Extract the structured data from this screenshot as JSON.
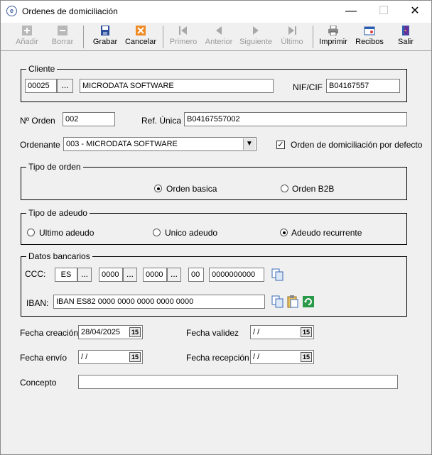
{
  "window": {
    "title": "Ordenes de domiciliación",
    "minimize": "—",
    "maximize": "☐",
    "close": "✕"
  },
  "toolbar": {
    "add": "Añadir",
    "delete": "Borrar",
    "save": "Grabar",
    "cancel": "Cancelar",
    "first": "Primero",
    "previous": "Anterior",
    "next": "Siguiente",
    "last": "Último",
    "print": "Imprimir",
    "receipts": "Recibos",
    "exit": "Salir"
  },
  "cliente": {
    "group_label": "Cliente",
    "code": "00025",
    "lookup": "...",
    "name": "MICRODATA SOFTWARE",
    "nif_label": "NIF/CIF",
    "nif": "B04167557"
  },
  "orden": {
    "num_label": "Nº Orden",
    "num": "002",
    "ref_label": "Ref. Única",
    "ref": "B04167557002",
    "ordenante_label": "Ordenante",
    "ordenante": "003 - MICRODATA SOFTWARE",
    "default_label": "Orden de domiciliación por defecto",
    "default_checked": true
  },
  "tipo_orden": {
    "group_label": "Tipo de orden",
    "basica": "Orden basica",
    "b2b": "Orden B2B",
    "selected": "basica"
  },
  "tipo_adeudo": {
    "group_label": "Tipo de adeudo",
    "ultimo": "Ultimo adeudo",
    "unico": "Unico adeudo",
    "recurrente": "Adeudo recurrente",
    "selected": "recurrente"
  },
  "bancarios": {
    "group_label": "Datos bancarios",
    "ccc_label": "CCC:",
    "country": "ES",
    "entity": "0000",
    "office": "0000",
    "dc": "00",
    "account": "0000000000",
    "lookup": "...",
    "iban_label": "IBAN:",
    "iban": "IBAN ES82 0000 0000 0000 0000 0000"
  },
  "fechas": {
    "creacion_label": "Fecha creación",
    "creacion": "28/04/2025",
    "validez_label": "Fecha validez",
    "validez": " / /",
    "envio_label": "Fecha envío",
    "envio": " / /",
    "recepcion_label": "Fecha recepción",
    "recepcion": " / /",
    "calendar_glyph": "15"
  },
  "concepto": {
    "label": "Concepto",
    "value": ""
  }
}
